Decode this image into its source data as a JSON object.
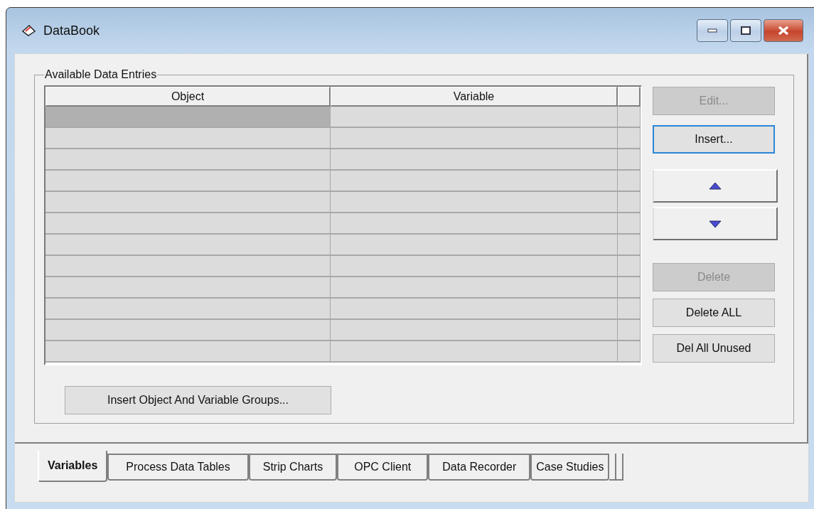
{
  "window": {
    "title": "DataBook"
  },
  "group": {
    "title": "Available Data Entries"
  },
  "table": {
    "columns": [
      "Object",
      "Variable"
    ],
    "rows": [
      {
        "selected": true
      },
      {
        "selected": false
      },
      {
        "selected": false
      },
      {
        "selected": false
      },
      {
        "selected": false
      },
      {
        "selected": false
      },
      {
        "selected": false
      },
      {
        "selected": false
      },
      {
        "selected": false
      },
      {
        "selected": false
      },
      {
        "selected": false
      },
      {
        "selected": false
      }
    ]
  },
  "side_buttons": [
    {
      "kind": "text",
      "label": "Edit...",
      "disabled": true,
      "focused": false
    },
    {
      "kind": "text",
      "label": "Insert...",
      "disabled": false,
      "focused": true
    },
    {
      "kind": "up"
    },
    {
      "kind": "down"
    },
    {
      "kind": "text",
      "label": "Delete",
      "disabled": true,
      "focused": false
    },
    {
      "kind": "text",
      "label": "Delete ALL",
      "disabled": false,
      "focused": false
    },
    {
      "kind": "text",
      "label": "Del All Unused",
      "disabled": false,
      "focused": false
    }
  ],
  "group_button": "Insert Object And Variable Groups...",
  "tabs": [
    {
      "label": "Variables",
      "selected": true
    },
    {
      "label": "Process Data Tables",
      "selected": false
    },
    {
      "label": "Strip Charts",
      "selected": false
    },
    {
      "label": "OPC Client",
      "selected": false
    },
    {
      "label": "Data Recorder",
      "selected": false
    },
    {
      "label": "Case Studies",
      "selected": false
    }
  ]
}
